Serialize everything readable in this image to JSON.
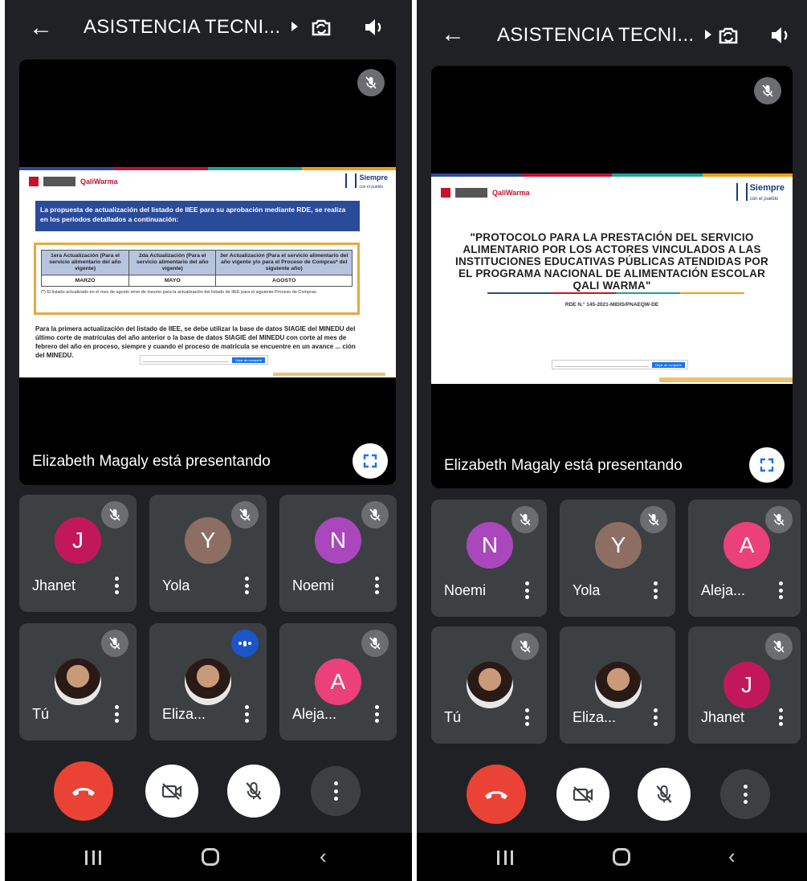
{
  "screens": [
    {
      "id": "screen-1",
      "title": "ASISTENCIA TECNI...",
      "presenting_text": "Elizabeth Magaly está presentando",
      "slide": {
        "logo_text": "QaliWarma",
        "siempre": "Siempre",
        "siempre_sub": "con el pueblo",
        "banner": "La propuesta de actualización del listado de IIEE para su aprobación mediante RDE, se realiza en los periodos detallados a continuación:",
        "table_headers": [
          "1era Actualización (Para el servicio alimentario del año vigente)",
          "2da Actualización (Para el servicio alimentario del año vigente)",
          "3er Actualización (Para el servicio alimentario del año vigente y/o para el Proceso de Compras* del siguiente año)"
        ],
        "table_values": [
          "MARZO",
          "MAYO",
          "AGOSTO"
        ],
        "note": "(*) El listado actualizado en el mes de agosto sirve de insumo para la actualización del listado de IIEE para el siguiente Proceso de Compras.",
        "body": "Para la primera actualización del listado de IIEE, se debe utilizar la base de datos SIAGIE del MINEDU del último corte de matrículas del año anterior o la base de datos SIAGIE del MINEDU con corte al mes de febrero del año en proceso, siempre y cuando el proceso de matrícula se encuentre en un avance ... ción del MINEDU.",
        "toolbar_button": "Dejar de compartir"
      },
      "tiles": [
        {
          "name": "Jhanet",
          "initial": "J",
          "color": "#c2185b",
          "type": "initial",
          "status": "muted"
        },
        {
          "name": "Yola",
          "initial": "Y",
          "color": "#8d6e63",
          "type": "initial",
          "status": "muted"
        },
        {
          "name": "Noemi",
          "initial": "N",
          "color": "#ab47bc",
          "type": "initial",
          "status": "muted"
        },
        {
          "name": "Tú",
          "initial": "",
          "color": "",
          "type": "photo",
          "status": "muted"
        },
        {
          "name": "Eliza...",
          "initial": "",
          "color": "",
          "type": "photo",
          "status": "speaking"
        },
        {
          "name": "Aleja...",
          "initial": "A",
          "color": "#ec407a",
          "type": "initial",
          "status": "muted"
        }
      ]
    },
    {
      "id": "screen-2",
      "title": "ASISTENCIA TECNI...",
      "presenting_text": "Elizabeth Magaly está presentando",
      "slide": {
        "logo_text": "QaliWarma",
        "siempre": "Siempre",
        "siempre_sub": "con el pueblo",
        "title": "\"PROTOCOLO PARA LA PRESTACIÓN DEL SERVICIO ALIMENTARIO POR LOS ACTORES VINCULADOS A LAS INSTITUCIONES EDUCATIVAS PÚBLICAS ATENDIDAS POR EL PROGRAMA NACIONAL DE ALIMENTACIÓN ESCOLAR QALI WARMA\"",
        "rde": "RDE N.° 145-2021-MIDIS/PNAEQW-DE",
        "toolbar_button": "Dejar de compartir"
      },
      "tiles": [
        {
          "name": "Noemi",
          "initial": "N",
          "color": "#ab47bc",
          "type": "initial",
          "status": "muted"
        },
        {
          "name": "Yola",
          "initial": "Y",
          "color": "#8d6e63",
          "type": "initial",
          "status": "muted"
        },
        {
          "name": "Aleja...",
          "initial": "A",
          "color": "#ec407a",
          "type": "initial",
          "status": "muted"
        },
        {
          "name": "Tú",
          "initial": "",
          "color": "",
          "type": "photo",
          "status": "muted"
        },
        {
          "name": "Eliza...",
          "initial": "",
          "color": "",
          "type": "photo",
          "status": "none"
        },
        {
          "name": "Jhanet",
          "initial": "J",
          "color": "#c2185b",
          "type": "initial",
          "status": "muted"
        }
      ]
    }
  ],
  "colors": {
    "background": "#202124",
    "tile": "#3c4043",
    "end_call": "#ea4335",
    "speaking": "#1a55c9"
  }
}
